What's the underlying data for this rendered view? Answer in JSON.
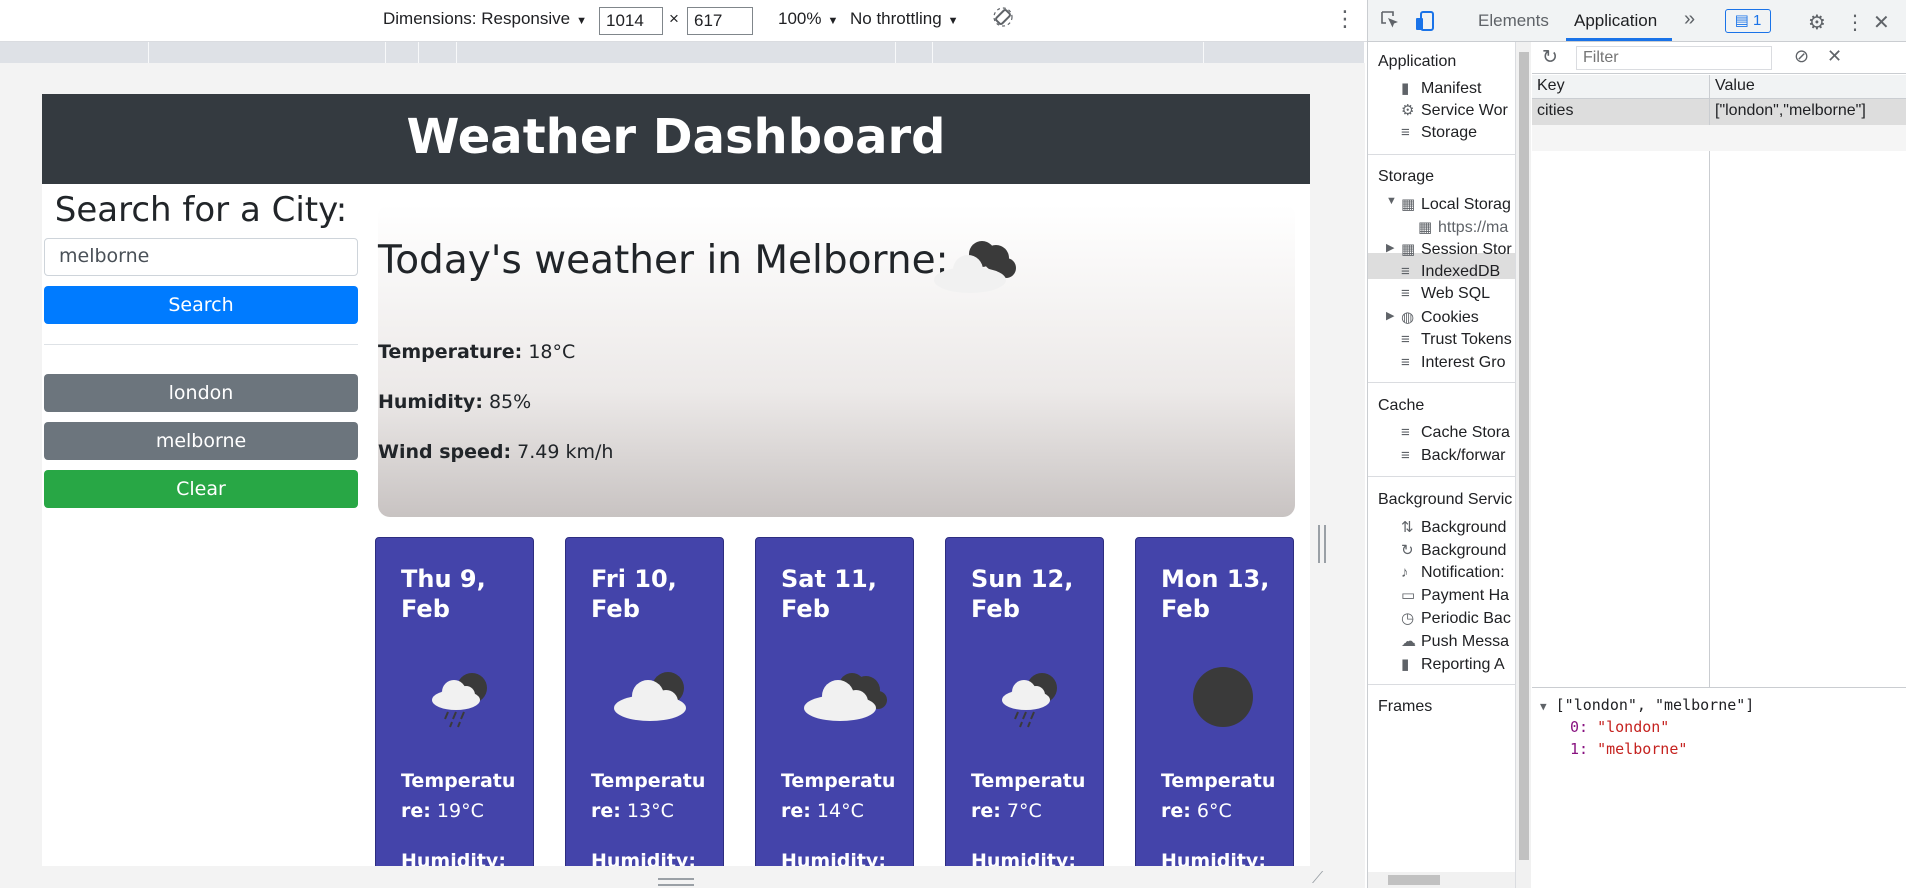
{
  "device_toolbar": {
    "dimensions_label": "Dimensions: Responsive",
    "width": "1014",
    "times": "×",
    "height": "617",
    "zoom": "100%",
    "throttling": "No throttling"
  },
  "app": {
    "header_title": "Weather Dashboard",
    "search_title": "Search for a City:",
    "city_input_value": "melborne",
    "search_button": "Search",
    "history": [
      "london",
      "melborne"
    ],
    "clear_button": "Clear",
    "today": {
      "title": "Today's weather in Melborne:",
      "temperature_label": "Temperature:",
      "temperature_value": "18°C",
      "humidity_label": "Humidity:",
      "humidity_value": "85%",
      "wind_label": "Wind speed:",
      "wind_value": "7.49 km/h",
      "icon": "cloud-sun-icon"
    },
    "forecast": [
      {
        "day": "Thu 9,",
        "month": "Feb",
        "icon": "cloud-rain-sun-icon",
        "temp_label_a": "Temperatu",
        "temp_label_b": "re:",
        "temp": "19°C",
        "humidity_label": "Humidity:"
      },
      {
        "day": "Fri 10,",
        "month": "Feb",
        "icon": "cloud-sun-icon",
        "temp_label_a": "Temperatu",
        "temp_label_b": "re:",
        "temp": "13°C",
        "humidity_label": "Humidity:"
      },
      {
        "day": "Sat 11,",
        "month": "Feb",
        "icon": "cloud-dark-icon",
        "temp_label_a": "Temperatu",
        "temp_label_b": "re:",
        "temp": "14°C",
        "humidity_label": "Humidity:"
      },
      {
        "day": "Sun 12,",
        "month": "Feb",
        "icon": "cloud-rain-sun-icon",
        "temp_label_a": "Temperatu",
        "temp_label_b": "re:",
        "temp": "7°C",
        "humidity_label": "Humidity:"
      },
      {
        "day": "Mon 13,",
        "month": "Feb",
        "icon": "dark-circle-icon",
        "temp_label_a": "Temperatu",
        "temp_label_b": "re:",
        "temp": "6°C",
        "humidity_label": "Humidity:"
      }
    ]
  },
  "devtools": {
    "tabs": [
      "Elements",
      "Application"
    ],
    "more": "»",
    "issues_count": "1",
    "sidebar": {
      "application_head": "Application",
      "application_items": [
        "Manifest",
        "Service Wor",
        "Storage"
      ],
      "storage_head": "Storage",
      "storage_items": [
        "Local Storag",
        "https://ma",
        "Session Stor",
        "IndexedDB",
        "Web SQL",
        "Cookies",
        "Trust Tokens",
        "Interest Gro"
      ],
      "cache_head": "Cache",
      "cache_items": [
        "Cache Stora",
        "Back/forwar"
      ],
      "background_head": "Background Servic",
      "background_items": [
        "Background",
        "Background",
        "Notification:",
        "Payment Ha",
        "Periodic Bac",
        "Push Messa",
        "Reporting A"
      ],
      "frames_head": "Frames"
    },
    "filter_placeholder": "Filter",
    "grid": {
      "headers": [
        "Key",
        "Value"
      ],
      "rows": [
        {
          "key": "cities",
          "value": "[\"london\",\"melborne\"]"
        }
      ]
    },
    "preview": {
      "summary": "[\"london\", \"melborne\"]",
      "items": [
        {
          "index": "0:",
          "value": "\"london\""
        },
        {
          "index": "1:",
          "value": "\"melborne\""
        }
      ]
    }
  }
}
